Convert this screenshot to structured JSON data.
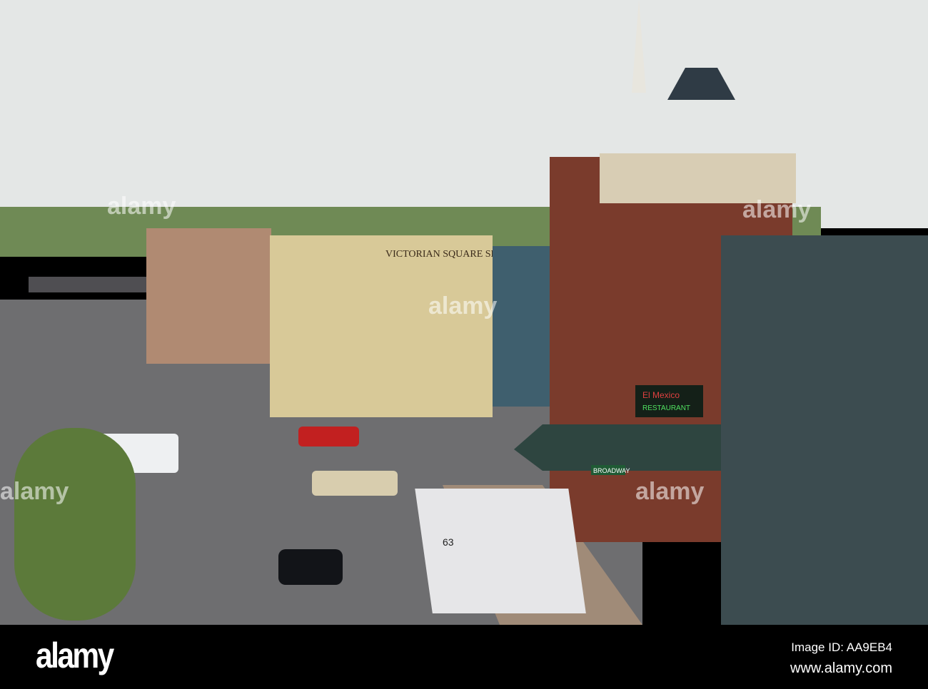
{
  "photo": {
    "signs": {
      "shoppe": "VICTORIAN SQUARE SHOPPE",
      "street": "BROADWAY",
      "restaurant_1": "El Mexico",
      "restaurant_2": "RESTAURANT",
      "bus_number": "63"
    },
    "watermark": "alamy"
  },
  "footer": {
    "logo": "alamy",
    "image_id": "Image ID: AA9EB4",
    "url": "www.alamy.com"
  }
}
